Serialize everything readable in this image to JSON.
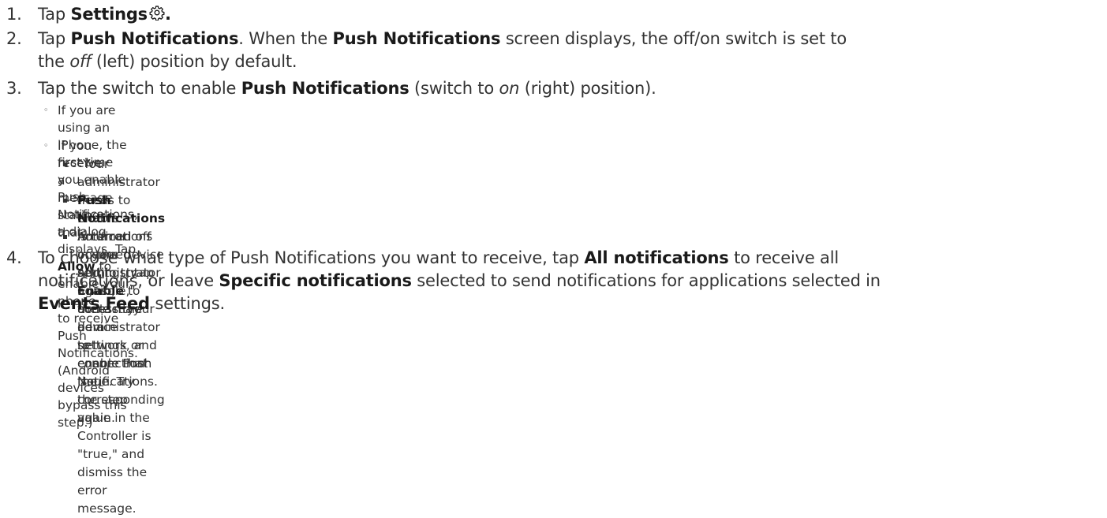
{
  "steps": [
    {
      "num": "1.",
      "parts": [
        {
          "t": "Tap "
        },
        {
          "b": "Settings"
        },
        {
          "icon": "gear-icon"
        },
        {
          "b": "."
        }
      ]
    },
    {
      "num": "2.",
      "parts": [
        {
          "t": "Tap "
        },
        {
          "b": "Push Notifications"
        },
        {
          "t": ". When the "
        },
        {
          "b": "Push Notifications"
        },
        {
          "t": " screen displays, the off/on switch is set to "
        },
        {
          "br": true
        },
        {
          "t": "the "
        },
        {
          "i": "off"
        },
        {
          "t": " (left) position by default."
        }
      ]
    },
    {
      "num": "3.",
      "parts": [
        {
          "t": "Tap the switch to enable "
        },
        {
          "b": "Push Notifications"
        },
        {
          "t": " (switch to "
        },
        {
          "i": "on"
        },
        {
          "t": " (right) position)."
        }
      ]
    },
    {
      "num": "4.",
      "parts": [
        {
          "t": "To choose what type of Push Notifications you want to receive, tap "
        },
        {
          "b": "All notifications"
        },
        {
          "t": " to receive all"
        },
        {
          "br": true
        },
        {
          "t": "notifications, or leave "
        },
        {
          "b": "Specific notifications"
        },
        {
          "t": " selected to send notifications for applications selected in"
        },
        {
          "br": true
        },
        {
          "b": "Events Feed"
        },
        {
          "t": " settings."
        }
      ]
    }
  ],
  "sub_bullets": [
    {
      "bullet": "◦",
      "parts": [
        {
          "t": "If you are using an iPhone, the first time you enable Push Notifications, a dialog displays. Tap "
        },
        {
          "b": "Allow"
        },
        {
          "t": " to enable your phone"
        },
        {
          "br": true
        },
        {
          "t": "to receive Push Notifications. (Android devices bypass this step.)"
        }
      ]
    },
    {
      "bullet": "◦",
      "parts": [
        {
          "t": "If you receive a message stating that:"
        }
      ]
    }
  ],
  "sub_sub_bullets": [
    {
      "parts": [
        {
          "t": "\"Your administrator needs to enable notifications on the Administrator Console,\" contact your administrator to"
        },
        {
          "br": true
        },
        {
          "t": "ensure that the corresponding value in the Controller is \"true,\" and dismiss the error message."
        }
      ]
    },
    {
      "parts": [
        {
          "b": "Push Notifications"
        },
        {
          "t": " is turned off in your device settings, tap "
        },
        {
          "b": "Enable"
        },
        {
          "t": " to access the device settings, and enable Push"
        },
        {
          "br": true
        },
        {
          "t": "Notifications."
        }
      ]
    },
    {
      "parts": [
        {
          "t": "An error occurred and to try again, there may be a network or connection issue. Try the step again."
        }
      ]
    }
  ]
}
